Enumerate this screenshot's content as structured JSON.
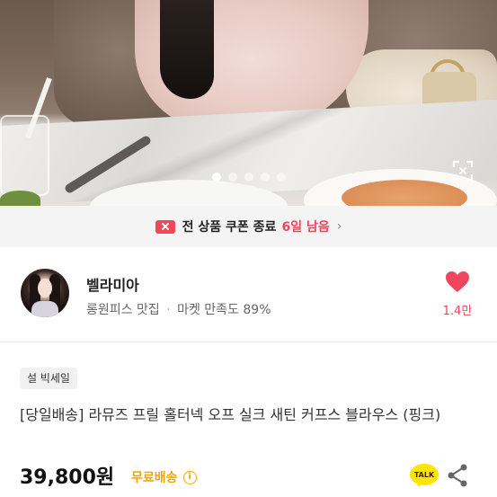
{
  "gallery": {
    "total_images": 5,
    "active_index": 0
  },
  "coupon_banner": {
    "text": "전 상품 쿠폰 종료",
    "remaining": "6일 남음",
    "chevron": "›",
    "accent_color": "#f0455a"
  },
  "seller": {
    "name": "벨라미아",
    "tagline": "롱원피스 맛집",
    "separator": "·",
    "satisfaction": "마켓 만족도 89%"
  },
  "like": {
    "count": "1.4만",
    "icon": "heart-icon"
  },
  "product": {
    "badge": "설 빅세일",
    "title": "[당일배송] 라뮤즈 프릴 홀터넥 오프 실크 새틴 커프스 블라우스 (핑크)",
    "price": "39,800원",
    "shipping": "무료배송",
    "shipping_color": "#f2a700",
    "info_glyph": "i"
  },
  "actions": {
    "talk_label": "TALK",
    "share_icon": "share-icon"
  }
}
